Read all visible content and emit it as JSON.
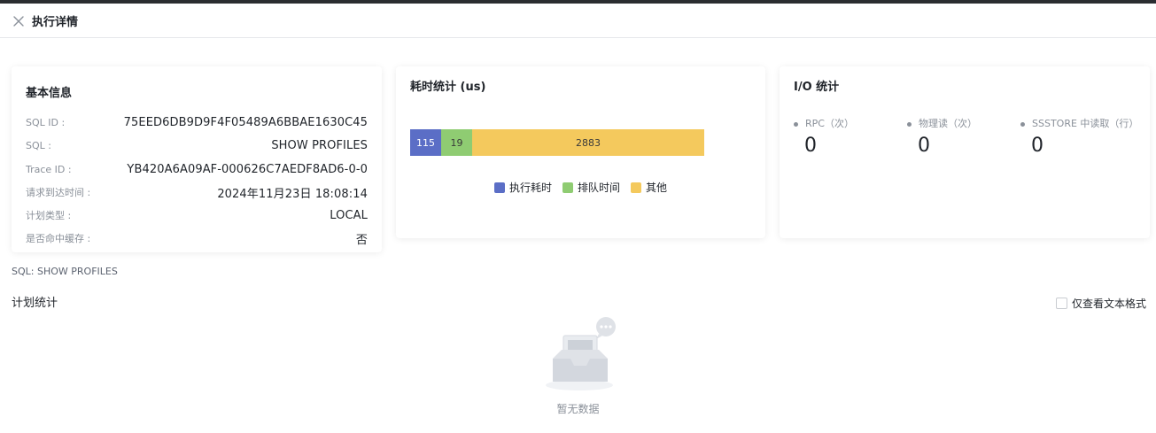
{
  "header": {
    "title": "执行详情",
    "close_icon": "close-icon"
  },
  "basic_info": {
    "title": "基本信息",
    "rows": [
      {
        "label": "SQL ID :",
        "value": "75EED6DB9D9F4F05489A6BBAE1630C45"
      },
      {
        "label": "SQL :",
        "value": "SHOW PROFILES"
      },
      {
        "label": "Trace ID :",
        "value": "YB420A6A09AF-000626C7AEDF8AD6-0-0"
      },
      {
        "label": "请求到达时间 :",
        "value": "2024年11月23日 18:08:14"
      },
      {
        "label": "计划类型 :",
        "value": "LOCAL"
      },
      {
        "label": "是否命中缓存 :",
        "value": "否"
      }
    ]
  },
  "time_stats": {
    "title": "耗时统计 (us)",
    "legend": [
      "执行耗时",
      "排队时间",
      "其他"
    ]
  },
  "chart_data": {
    "type": "bar",
    "orientation": "horizontal-stacked",
    "title": "耗时统计 (us)",
    "series": [
      {
        "name": "执行耗时",
        "values": [
          115
        ],
        "color": "#5b6ec6"
      },
      {
        "name": "排队时间",
        "values": [
          19
        ],
        "color": "#8fcc72"
      },
      {
        "name": "其他",
        "values": [
          2883
        ],
        "color": "#f4c95d"
      }
    ],
    "legend_position": "bottom-center",
    "grid": false
  },
  "io_stats": {
    "title": "I/O 统计",
    "items": [
      {
        "label": "RPC（次）",
        "value": "0"
      },
      {
        "label": "物理读（次）",
        "value": "0"
      },
      {
        "label": "SSSTORE 中读取（行）",
        "value": "0"
      }
    ]
  },
  "sql_line": "SQL: SHOW PROFILES",
  "plan": {
    "title": "计划统计",
    "text_only_label": "仅查看文本格式",
    "text_only_checked": false,
    "empty_text": "暂无数据"
  }
}
